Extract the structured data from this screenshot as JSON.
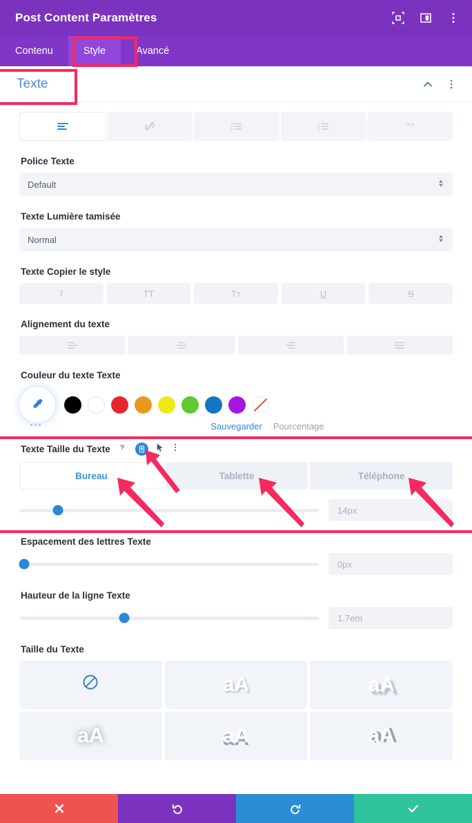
{
  "header": {
    "title": "Post Content Paramètres",
    "icons": [
      {
        "name": "fullscreen-icon"
      },
      {
        "name": "split-view-icon"
      },
      {
        "name": "more-vertical-icon"
      }
    ],
    "tabs": [
      {
        "label": "Contenu",
        "active": false
      },
      {
        "label": "Style",
        "active": true
      },
      {
        "label": "Avancé",
        "active": false
      }
    ]
  },
  "section": {
    "title": "Texte",
    "collapse_icon": "chevron-up-icon",
    "menu_icon": "more-vertical-icon"
  },
  "text_toolbar": [
    {
      "name": "paragraph-icon",
      "active": true
    },
    {
      "name": "link-icon",
      "active": false
    },
    {
      "name": "bullet-list-icon",
      "active": false
    },
    {
      "name": "numbered-list-icon",
      "active": false
    },
    {
      "name": "quote-icon",
      "active": false
    }
  ],
  "fields": {
    "font": {
      "label": "Police Texte",
      "value": "Default"
    },
    "weight": {
      "label": "Texte Lumière tamisée",
      "value": "Normal"
    },
    "style": {
      "label": "Texte Copier le style",
      "buttons": [
        {
          "name": "italic-button",
          "glyph": "I"
        },
        {
          "name": "uppercase-button",
          "glyph": "TT"
        },
        {
          "name": "smallcaps-button",
          "glyph": "Tт"
        },
        {
          "name": "underline-button",
          "glyph": "U"
        },
        {
          "name": "strikethrough-button",
          "glyph": "S"
        }
      ]
    },
    "alignment": {
      "label": "Alignement du texte",
      "buttons": [
        {
          "name": "align-left-icon"
        },
        {
          "name": "align-center-icon"
        },
        {
          "name": "align-right-icon"
        },
        {
          "name": "align-justify-icon"
        }
      ]
    },
    "color": {
      "label": "Couleur du texte Texte",
      "eyedropper": "eyedropper-icon",
      "swatches": [
        {
          "name": "swatch-black",
          "hex": "#000000"
        },
        {
          "name": "swatch-white",
          "hex": "#ffffff"
        },
        {
          "name": "swatch-red",
          "hex": "#E8272C"
        },
        {
          "name": "swatch-orange",
          "hex": "#E8981B"
        },
        {
          "name": "swatch-yellow",
          "hex": "#EDE915"
        },
        {
          "name": "swatch-green",
          "hex": "#5FC92E"
        },
        {
          "name": "swatch-blue",
          "hex": "#1275C4"
        },
        {
          "name": "swatch-purple",
          "hex": "#A715E0"
        },
        {
          "name": "swatch-none",
          "hex": "none"
        }
      ],
      "save_label": "Sauvegarder",
      "percent_label": "Pourcentage"
    },
    "text_size": {
      "label": "Texte Taille du Texte",
      "help_icon": "help-icon",
      "responsive_icon": "mobile-device-icon",
      "pointer_icon": "cursor-pointer-icon",
      "menu_icon": "more-vertical-icon",
      "devices": [
        {
          "label": "Bureau",
          "active": true
        },
        {
          "label": "Tablette",
          "active": false
        },
        {
          "label": "Téléphone",
          "active": false
        }
      ],
      "value": "14px",
      "knob_percent": 13
    },
    "letter_spacing": {
      "label": "Espacement des lettres Texte",
      "value": "0px",
      "knob_percent": 1
    },
    "line_height": {
      "label": "Hauteur de la ligne Texte",
      "value": "1.7em",
      "knob_percent": 35
    },
    "text_shadow": {
      "label": "Taille du Texte",
      "cells": [
        {
          "name": "shadow-none-cell",
          "glyph": "",
          "icon": "no-shadow-icon"
        },
        {
          "name": "shadow-soft-cell",
          "glyph": "aA"
        },
        {
          "name": "shadow-hard-cell",
          "glyph": "aA"
        },
        {
          "name": "shadow-glow-cell",
          "glyph": "aA"
        },
        {
          "name": "shadow-down-cell",
          "glyph": "aA"
        },
        {
          "name": "shadow-right-cell",
          "glyph": "aA"
        }
      ]
    }
  },
  "bottom_bar": [
    {
      "name": "cancel-button",
      "icon": "close-icon",
      "color": "#EE5350"
    },
    {
      "name": "undo-button",
      "icon": "undo-icon",
      "color": "#7B32BE"
    },
    {
      "name": "redo-button",
      "icon": "redo-icon",
      "color": "#2B8DD6"
    },
    {
      "name": "save-button",
      "icon": "check-icon",
      "color": "#2FC49B"
    }
  ],
  "annotations": {
    "highlight_color": "#F52A5E"
  }
}
